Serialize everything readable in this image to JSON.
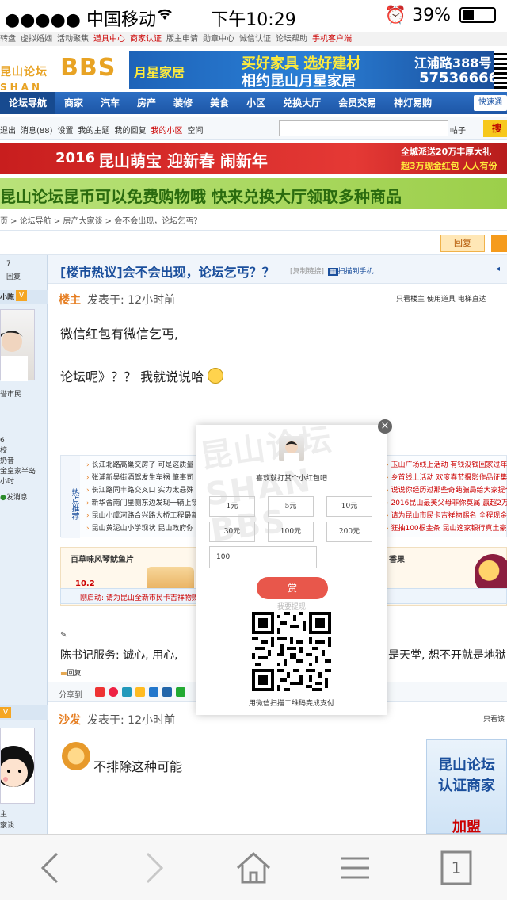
{
  "status": {
    "carrier": "●●●●● 中国移动",
    "time": "下午10:29",
    "battery": "39%",
    "battery_level": 0.39
  },
  "toplinks": [
    {
      "label": "转盘",
      "red": false
    },
    {
      "label": "虚拟婚姻",
      "red": false
    },
    {
      "label": "活动聚焦",
      "red": false
    },
    {
      "label": "道具中心",
      "red": true
    },
    {
      "label": "商家认证",
      "red": true
    },
    {
      "label": "版主申请",
      "red": false
    },
    {
      "label": "勋章中心",
      "red": false
    },
    {
      "label": "诚信认证",
      "red": false
    },
    {
      "label": "论坛帮助",
      "red": false
    },
    {
      "label": "手机客户端",
      "red": true
    }
  ],
  "banner": {
    "logo_cn": "昆山论坛",
    "logo_en": "SHAN",
    "logo_bbs": "BBS",
    "ad_brand": "月星家居",
    "ad_line1": "买好家具 选好建材",
    "ad_line2": "相约昆山月星家居",
    "ad_addr": "江浦路388号",
    "ad_phone": "57536666"
  },
  "nav": {
    "items": [
      "论坛导航",
      "商家",
      "汽车",
      "房产",
      "装修",
      "美食",
      "小区",
      "兑换大厅",
      "会员交易",
      "神灯易购"
    ],
    "active": 0,
    "quick": "快速通"
  },
  "userbar": {
    "links": [
      "退出",
      "消息(88)",
      "设置",
      "我的主题",
      "我的回复",
      "我的小区",
      "空间"
    ],
    "posts_label": "帖子",
    "search_label": "搜"
  },
  "ad2": {
    "year": "2016",
    "text": "昆山萌宝 迎新春 闹新年",
    "right1": "全城派送20万丰厚大礼",
    "right2": "超3万现金红包 人人有份"
  },
  "ad3": {
    "text": "昆山论坛昆币可以免费购物哦 快来兑换大厅领取多种商品"
  },
  "breadcrumb": [
    "页",
    "论坛导航",
    "房产大家谈",
    "会不会出现，论坛乞丐？"
  ],
  "actions": {
    "reply": "回复"
  },
  "left": {
    "counts": "7",
    "reply": "回复",
    "user1": "小陈",
    "level": "V",
    "role1": "誉市民",
    "stats": [
      "6",
      "校",
      "奶昔",
      "金皇家半岛",
      "小时"
    ],
    "send_msg": "发消息",
    "role2": "主",
    "role3": "家谈"
  },
  "thread": {
    "title": "[楼市热议]会不会出现，论坛乞丐？？",
    "copy_link": "[复制链接]",
    "scan": "扫描到手机",
    "op_label": "楼主",
    "posted": "发表于: 12小时前",
    "tools": "只看楼主  使用道具  电梯直达",
    "body_line1": "微信红包有微信乞丐,",
    "body_line2": "论坛呢》？？ 我就说说哈",
    "hot_label": "热点推荐",
    "hot_left": [
      "长江北路高巢交房了 可是这质量",
      "张浦新昊街酒驾发生车祸 肇事司",
      "长江路同丰路交叉口 实力太悬殊",
      "新华舍南门里侧东边发现一辆上锁",
      "昆山小虞河路合兴路大桥工程最新",
      "昆山黄泥山小学现状 昆山政府你"
    ],
    "hot_right": [
      "玉山广场线上活动 有钱没钱回家过年",
      "乡首线上活动 欢度春节摄影作品征集中",
      "说说你经历过那些奇葩骗局给大家提个",
      "2016昆山最美父母非你莫属 赢超2万现",
      "请为昆山市民卡吉祥物赐名 全程现金奖",
      "狂抽100根金条 昆山这家银行真土豪"
    ],
    "prod1": "百草味风琴鱿鱼片",
    "prod1_price": "10.2",
    "prod2": "香果",
    "notice": "刚启动: 请为昆山全新市民卡吉祥物赐",
    "sig": "陈书记服务: 诚心, 用心,",
    "sig_tail": "是天堂, 想不开就是地狱",
    "reply_small": "回复",
    "share": "分享到",
    "second_label": "沙发",
    "second_posted": "发表于: 12小时前",
    "second_tools": "只看该",
    "second_body": "不排除这种可能",
    "ad4_line1": "昆山论坛",
    "ad4_line2": "认证商家",
    "ad4_line3": "加盟"
  },
  "modal": {
    "watermark": "昆山论坛 SHAN BBS",
    "message": "喜欢就打赏个小红包吧",
    "amounts": [
      "1元",
      "5元",
      "10元",
      "30元",
      "100元",
      "200元"
    ],
    "custom_value": "100",
    "give": "赏",
    "withdraw": "我要提现",
    "qr_note": "用微信扫描二维码完成支付"
  },
  "bottom": {
    "tabs_count": "1"
  }
}
